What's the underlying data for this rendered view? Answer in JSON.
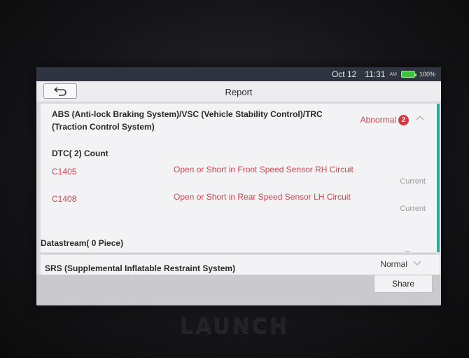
{
  "statusbar": {
    "date": "Oct 12",
    "time": "11:31",
    "ampm": "AM",
    "battery": "100%"
  },
  "header": {
    "title": "Report",
    "back_icon": "back-arrow-icon"
  },
  "systems": [
    {
      "name": "ABS (Anti-lock Braking System)/VSC (Vehicle Stability Control)/TRC (Traction Control System)",
      "status": "Abnormal",
      "error_count": "2",
      "dtc_count_label": "DTC( 2) Count",
      "dtcs": [
        {
          "code": "C1405",
          "description": "Open or Short in Front Speed Sensor RH Circuit",
          "state": "Current"
        },
        {
          "code": "C1408",
          "description": "Open or Short in Rear Speed Sensor LH Circuit",
          "state": "Current"
        }
      ],
      "datastream_label": "Datastream( 0 Piece)"
    },
    {
      "name": "SRS (Supplemental Inflatable Restraint System)",
      "status": "Normal"
    }
  ],
  "footer": {
    "share_label": "Share"
  },
  "device": {
    "brand": "LAUNCH"
  },
  "colors": {
    "accent": "#2fa9a6",
    "error": "#d0454c",
    "badge": "#d9363e"
  }
}
